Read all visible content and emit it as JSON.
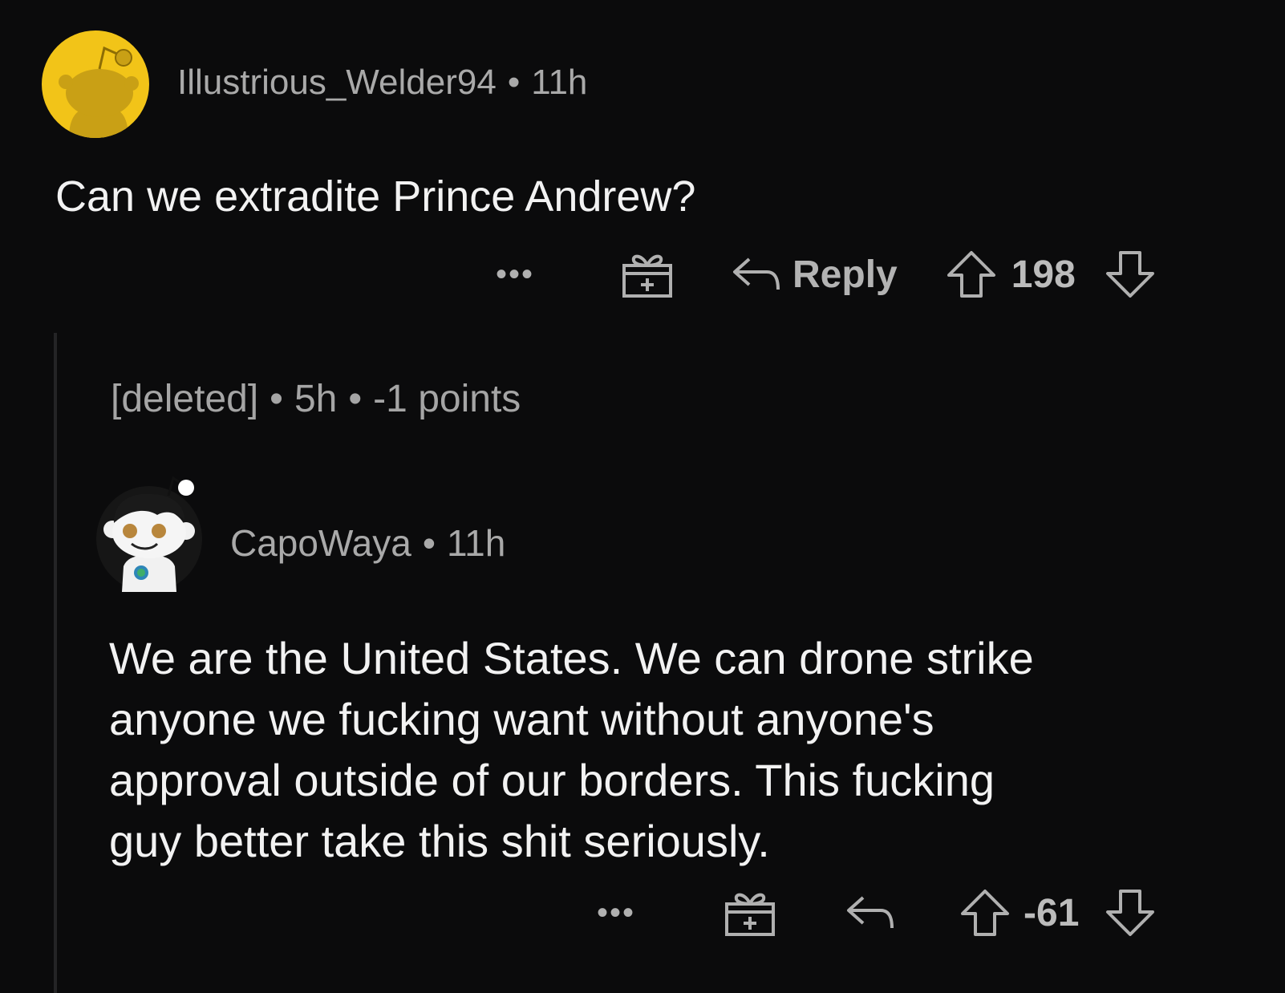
{
  "comment_1": {
    "username": "Illustrious_Welder94",
    "separator": "•",
    "time": "11h",
    "body": "Can we extradite Prince Andrew?",
    "actions": {
      "more_label": "•••",
      "award_icon": "gift-icon",
      "reply_label": "Reply",
      "score": "198"
    }
  },
  "deleted_comment": {
    "username": "[deleted]",
    "separator": "•",
    "time": "5h",
    "points": "-1 points"
  },
  "comment_2": {
    "username": "CapoWaya",
    "separator": "•",
    "time": "11h",
    "body_lines": [
      "We are the United States.  We can drone strike",
      "anyone we fucking want without anyone's",
      "approval outside of our borders.  This fucking",
      "guy better take this shit seriously."
    ],
    "actions": {
      "more_label": "•••",
      "award_icon": "gift-icon",
      "score": "-61"
    }
  },
  "colors": {
    "background": "#0b0b0c",
    "avatar_1_bg": "#f2c418",
    "text_primary": "#f2f2f2",
    "text_secondary": "#a9a9a9"
  }
}
